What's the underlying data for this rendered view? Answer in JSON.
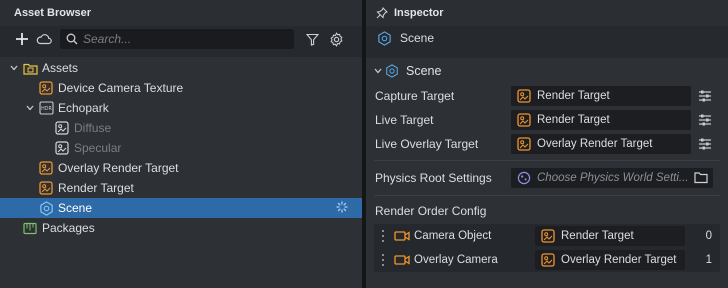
{
  "asset_browser": {
    "title": "Asset Browser",
    "search_placeholder": "Search...",
    "tree": [
      {
        "label": "Assets"
      },
      {
        "label": "Device Camera Texture"
      },
      {
        "label": "Echopark"
      },
      {
        "label": "Diffuse"
      },
      {
        "label": "Specular"
      },
      {
        "label": "Overlay Render Target"
      },
      {
        "label": "Render Target"
      },
      {
        "label": "Scene"
      },
      {
        "label": "Packages"
      }
    ]
  },
  "inspector": {
    "title": "Inspector",
    "object_name": "Scene",
    "section_title": "Scene",
    "properties": [
      {
        "label": "Capture Target",
        "value": "Render Target"
      },
      {
        "label": "Live Target",
        "value": "Render Target"
      },
      {
        "label": "Live Overlay Target",
        "value": "Overlay Render Target"
      }
    ],
    "physics": {
      "label": "Physics Root Settings",
      "placeholder": "Choose Physics World Setti..."
    },
    "render_order": {
      "title": "Render Order Config",
      "rows": [
        {
          "label": "Camera Object",
          "target": "Render Target",
          "order": "0"
        },
        {
          "label": "Overlay Camera",
          "target": "Overlay Render Target",
          "order": "1"
        }
      ]
    }
  },
  "colors": {
    "selection": "#2f6aa8",
    "asset_orange": "#f0962e",
    "scene_blue": "#5aa9e8",
    "package_green": "#7cc36a"
  }
}
